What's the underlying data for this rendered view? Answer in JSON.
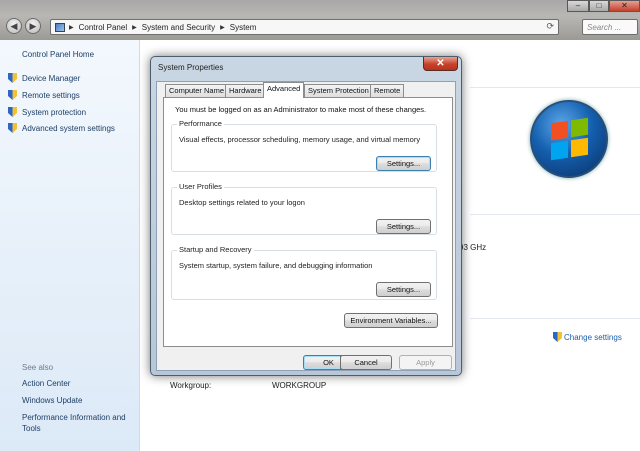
{
  "explorer": {
    "breadcrumbs": [
      "Control Panel",
      "System and Security",
      "System"
    ],
    "search_placeholder": "Search ...",
    "caption_min": "–",
    "caption_max": "□",
    "caption_close": "✕"
  },
  "sidebar": {
    "home": "Control Panel Home",
    "tasks": [
      "Device Manager",
      "Remote settings",
      "System protection",
      "Advanced system settings"
    ],
    "see_also_title": "See also",
    "see_also": [
      "Action Center",
      "Windows Update",
      "Performance Information and",
      "Tools"
    ]
  },
  "background": {
    "processor_speed": "93 GHz",
    "change_settings": "Change settings",
    "workgroup_label": "Workgroup:",
    "workgroup_value": "WORKGROUP"
  },
  "dialog": {
    "title": "System Properties",
    "close": "✕",
    "tabs": [
      "Computer Name",
      "Hardware",
      "Advanced",
      "System Protection",
      "Remote"
    ],
    "active_tab": "Advanced",
    "admin_message": "You must be logged on as an Administrator to make most of these changes.",
    "groups": {
      "performance": {
        "title": "Performance",
        "desc": "Visual effects, processor scheduling, memory usage, and virtual memory",
        "button": "Settings..."
      },
      "profiles": {
        "title": "User Profiles",
        "desc": "Desktop settings related to your logon",
        "button": "Settings..."
      },
      "startup": {
        "title": "Startup and Recovery",
        "desc": "System startup, system failure, and debugging information",
        "button": "Settings..."
      }
    },
    "env_button": "Environment Variables...",
    "ok": "OK",
    "cancel": "Cancel",
    "apply": "Apply"
  }
}
